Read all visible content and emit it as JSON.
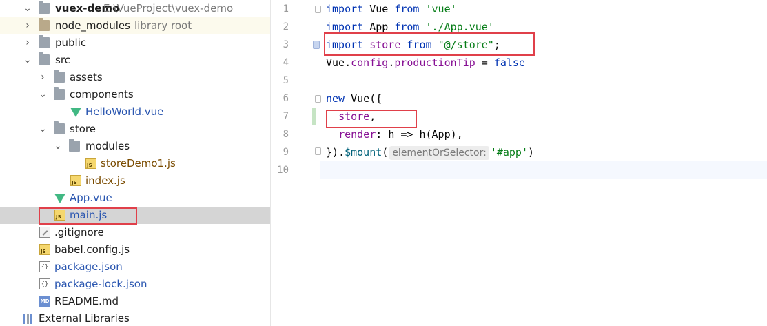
{
  "project_tree": {
    "root": {
      "name": "vuex-demo",
      "path": "E:\\VueProject\\vuex-demo"
    },
    "items": [
      {
        "label": "node_modules",
        "hint": "library root"
      },
      {
        "label": "public"
      },
      {
        "label": "src"
      },
      {
        "label": "assets"
      },
      {
        "label": "components"
      },
      {
        "label": "HelloWorld.vue"
      },
      {
        "label": "store"
      },
      {
        "label": "modules"
      },
      {
        "label": "storeDemo1.js"
      },
      {
        "label": "index.js"
      },
      {
        "label": "App.vue"
      },
      {
        "label": "main.js"
      },
      {
        "label": ".gitignore"
      },
      {
        "label": "babel.config.js"
      },
      {
        "label": "package.json"
      },
      {
        "label": "package-lock.json"
      },
      {
        "label": "README.md"
      },
      {
        "label": "External Libraries"
      }
    ],
    "icon_text": {
      "js": "JS",
      "md": "MD",
      "json": "{}"
    }
  },
  "editor": {
    "line_numbers": [
      "1",
      "2",
      "3",
      "4",
      "5",
      "6",
      "7",
      "8",
      "9",
      "10"
    ],
    "lines": [
      {
        "kw1": "import",
        "mid": " Vue ",
        "kw2": "from",
        "sp": " ",
        "str": "'vue'"
      },
      {
        "kw1": "import",
        "mid": " App ",
        "kw2": "from",
        "sp": " ",
        "str": "'./App.vue'"
      },
      {
        "kw1": "import",
        "mid": " ",
        "prop": "store",
        "sp1": " ",
        "kw2": "from",
        "sp2": " ",
        "str": "\"@/store\"",
        "end": ";"
      },
      {
        "obj": "Vue.",
        "prop1": "config",
        "dot": ".",
        "prop2": "productionTip",
        "op": " = ",
        "kw": "false"
      },
      {},
      {
        "kw": "new",
        "rest": " Vue({"
      },
      {
        "indent": "  ",
        "prop": "store",
        "end": ","
      },
      {
        "indent": "  ",
        "prop": "render",
        "colon": ": ",
        "h1": "h",
        "arrow": " => ",
        "h2": "h",
        "args": "(App),"
      },
      {
        "start": "})",
        "dot": ".",
        "fn": "$mount",
        "paren": "(",
        "hint": "elementOrSelector:",
        "str": "'#app'",
        "end": ")"
      },
      {}
    ]
  }
}
